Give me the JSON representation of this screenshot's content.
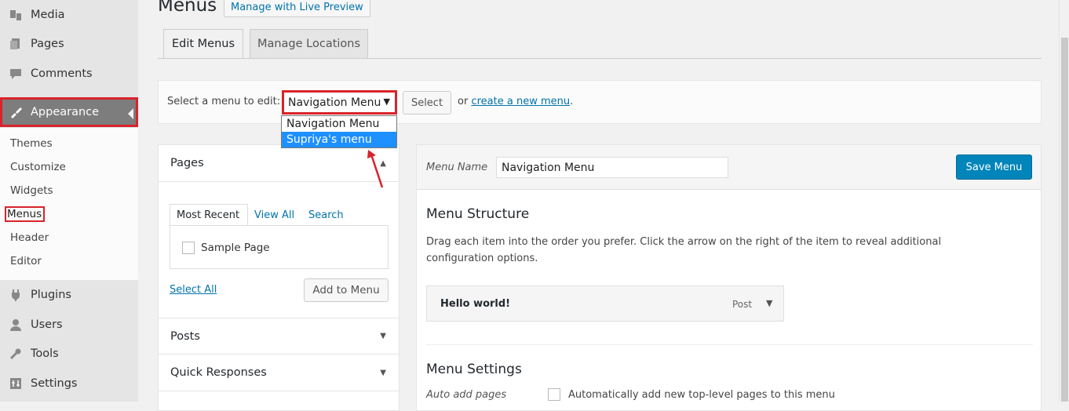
{
  "sidebar": {
    "items": [
      {
        "label": "Media",
        "icon": "media-icon"
      },
      {
        "label": "Pages",
        "icon": "pages-icon"
      },
      {
        "label": "Comments",
        "icon": "comments-icon"
      },
      {
        "label": "Appearance",
        "icon": "appearance-brush-icon"
      },
      {
        "label": "Plugins",
        "icon": "plugins-icon"
      },
      {
        "label": "Users",
        "icon": "users-icon"
      },
      {
        "label": "Tools",
        "icon": "tools-icon"
      },
      {
        "label": "Settings",
        "icon": "settings-icon"
      }
    ],
    "submenu": [
      "Themes",
      "Customize",
      "Widgets",
      "Menus",
      "Header",
      "Editor"
    ]
  },
  "header": {
    "title": "Menus",
    "preview_button": "Manage with Live Preview",
    "tabs": [
      "Edit Menus",
      "Manage Locations"
    ]
  },
  "select_bar": {
    "label": "Select a menu to edit:",
    "selected": "Navigation Menu",
    "select_button": "Select",
    "or_text": "or",
    "create_link": "create a new menu",
    "period": "."
  },
  "dropdown": {
    "options": [
      "Navigation Menu",
      "Supriya's menu"
    ]
  },
  "left_panel": {
    "pages_title": "Pages",
    "inner_tabs": [
      "Most Recent",
      "View All",
      "Search"
    ],
    "item": "Sample Page",
    "select_all": "Select All",
    "add_button": "Add to Menu",
    "posts_title": "Posts",
    "quick_title": "Quick Responses"
  },
  "right_panel": {
    "menu_name_label": "Menu Name",
    "menu_name_value": "Navigation Menu",
    "save_button": "Save Menu",
    "structure_title": "Menu Structure",
    "structure_desc": "Drag each item into the order you prefer. Click the arrow on the right of the item to reveal additional configuration options.",
    "menu_item": {
      "title": "Hello world!",
      "type": "Post"
    },
    "settings_title": "Menu Settings",
    "auto_label": "Auto add pages",
    "auto_text": "Automatically add new top-level pages to this menu"
  },
  "colors": {
    "highlight_border": "#d9232a",
    "primary_button": "#0085ba",
    "link": "#0073aa",
    "dropdown_highlight": "#1e90ff"
  }
}
